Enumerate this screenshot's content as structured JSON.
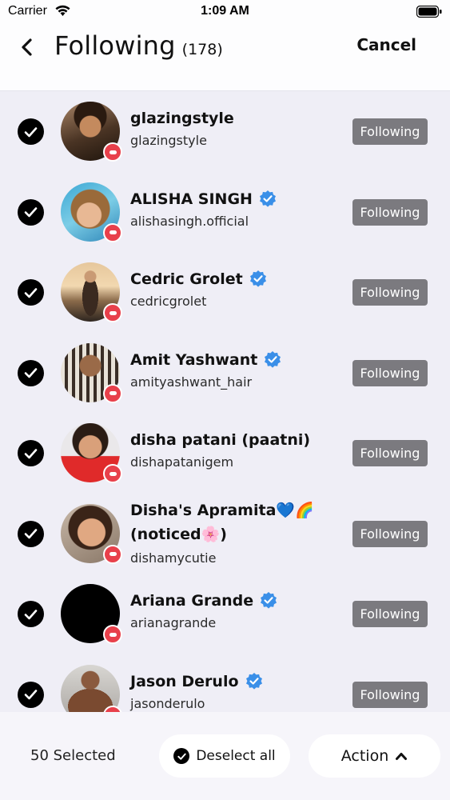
{
  "status_bar": {
    "carrier": "Carrier",
    "time": "1:09 AM"
  },
  "header": {
    "title": "Following",
    "count": "(178)",
    "cancel_label": "Cancel"
  },
  "colors": {
    "button_gray": "#7b7a7f",
    "verified_blue": "#3a8fe8",
    "live_red": "#e8404b",
    "list_bg": "#efeef6"
  },
  "icons": {
    "back": "chevron-left-icon",
    "check": "checkmark-icon",
    "verified": "verified-badge-icon",
    "live": "live-badge-icon",
    "action_toggle": "chevron-up-icon"
  },
  "accounts": [
    {
      "name": "glazingstyle",
      "handle": "glazingstyle",
      "verified": false,
      "selected": true,
      "button": "Following"
    },
    {
      "name": "ALISHA SINGH",
      "handle": "alishasingh.official",
      "verified": true,
      "selected": true,
      "button": "Following"
    },
    {
      "name": "Cedric Grolet",
      "handle": "cedricgrolet",
      "verified": true,
      "selected": true,
      "button": "Following"
    },
    {
      "name": "Amit Yashwant",
      "handle": "amityashwant_hair",
      "verified": true,
      "selected": true,
      "button": "Following"
    },
    {
      "name": "disha patani (paatni)",
      "handle": "dishapatanigem",
      "verified": false,
      "selected": true,
      "button": "Following"
    },
    {
      "name": "Disha's Apramita💙🌈",
      "name2": "(noticed🌸)",
      "handle": "dishamycutie",
      "verified": false,
      "selected": true,
      "button": "Following"
    },
    {
      "name": "Ariana Grande",
      "handle": "arianagrande",
      "verified": true,
      "selected": true,
      "button": "Following"
    },
    {
      "name": "Jason Derulo",
      "handle": "jasonderulo",
      "verified": true,
      "selected": true,
      "button": "Following"
    }
  ],
  "bottom_bar": {
    "selected_label": "50 Selected",
    "deselect_label": "Deselect all",
    "action_label": "Action"
  }
}
